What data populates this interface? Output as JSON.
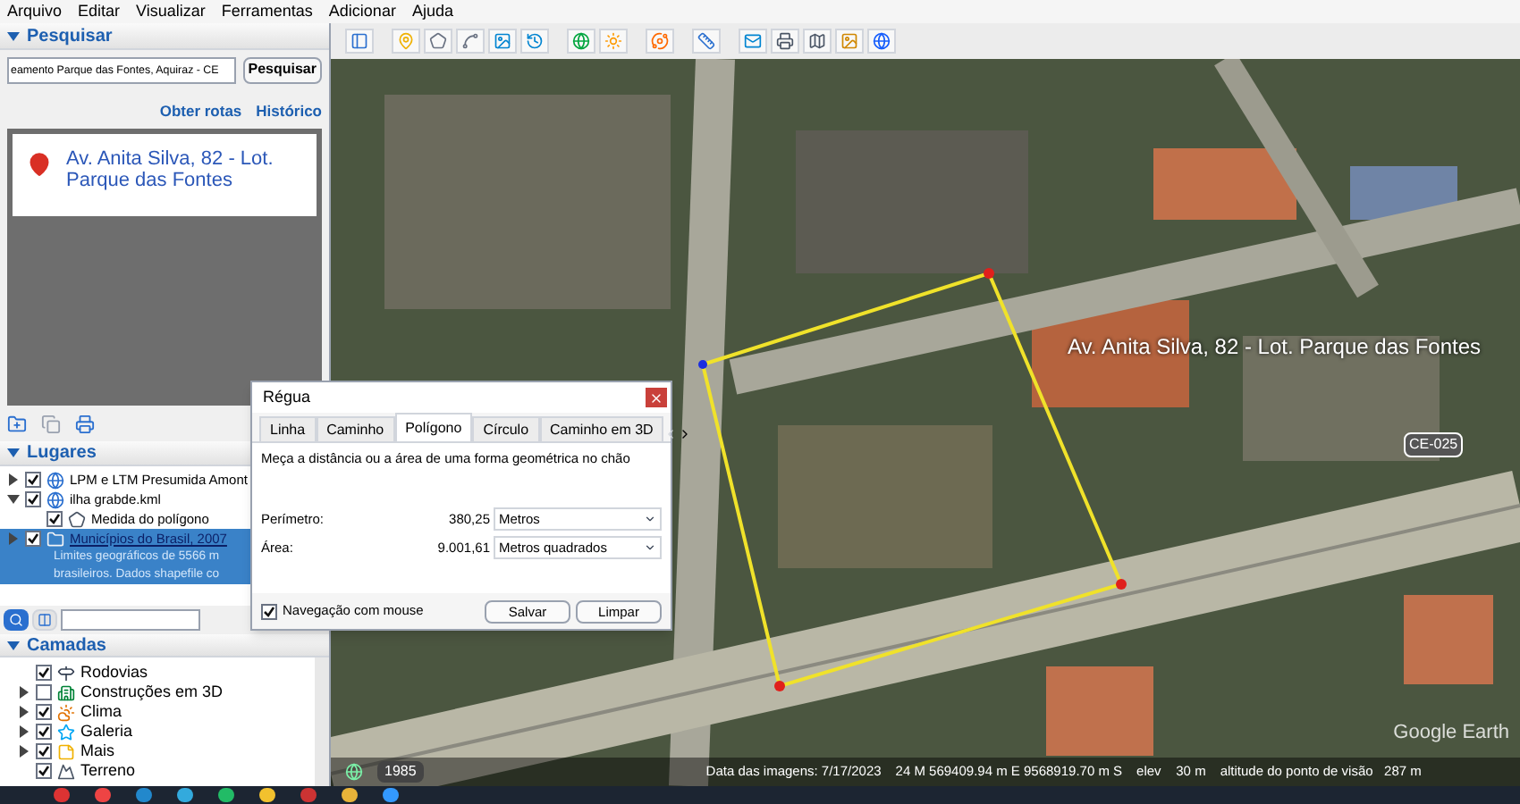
{
  "menu": [
    "Arquivo",
    "Editar",
    "Visualizar",
    "Ferramentas",
    "Adicionar",
    "Ajuda"
  ],
  "search_panel": {
    "title": "Pesquisar",
    "expanded": true,
    "query": "eamento Parque das Fontes, Aquiraz - CE",
    "button": "Pesquisar",
    "links": [
      "Obter rotas",
      "Histórico"
    ],
    "results": [
      {
        "title": "Av. Anita Silva, 82 - Lot. Parque das Fontes"
      }
    ]
  },
  "places": {
    "title": "Lugares",
    "expanded": true,
    "items": [
      {
        "label": "LPM e LTM Presumida Amont",
        "kind": "network",
        "checked": true,
        "expanded": false,
        "selected": false
      },
      {
        "label": "ilha grabde.kml",
        "kind": "network",
        "checked": true,
        "expanded": true,
        "selected": false,
        "children": [
          {
            "label": "Medida do polígono",
            "kind": "polygon",
            "checked": true,
            "selected": false
          }
        ]
      },
      {
        "label": "Municípios do Brasil, 2007",
        "kind": "folder",
        "checked": true,
        "expanded": false,
        "selected": true,
        "description_lines": [
          "Limites geográficos de 5566 m",
          "brasileiros. Dados shapefile co"
        ]
      }
    ]
  },
  "layers": {
    "title": "Camadas",
    "expanded": true,
    "items": [
      {
        "label": "Rodovias",
        "kind": "roads",
        "checked": true
      },
      {
        "label": "Construções em 3D",
        "kind": "buildings",
        "checked": false,
        "expanded": false
      },
      {
        "label": "Clima",
        "kind": "weather",
        "checked": true,
        "expanded": false
      },
      {
        "label": "Galeria",
        "kind": "gallery",
        "checked": true,
        "expanded": false
      },
      {
        "label": "Mais",
        "kind": "more",
        "checked": true,
        "expanded": false
      },
      {
        "label": "Terreno",
        "kind": "terrain",
        "checked": true
      }
    ]
  },
  "ruler_dialog": {
    "title": "Régua",
    "tabs": [
      {
        "label": "Linha",
        "selected": false
      },
      {
        "label": "Caminho",
        "selected": false
      },
      {
        "label": "Polígono",
        "selected": true
      },
      {
        "label": "Círculo",
        "selected": false
      },
      {
        "label": "Caminho em 3D",
        "selected": false
      }
    ],
    "description": "Meça a distância ou a área de uma forma geométrica no chão",
    "measurements": [
      {
        "label": "Perímetro:",
        "value": "380,25",
        "unit": "Metros"
      },
      {
        "label": "Área:",
        "value": "9.001,61",
        "unit": "Metros quadrados"
      }
    ],
    "mouse_navigation": {
      "label": "Navegação com mouse",
      "checked": true
    },
    "buttons": [
      "Salvar",
      "Limpar"
    ]
  },
  "map": {
    "place_label": "Av. Anita Silva, 82 - Lot. Parque das Fontes",
    "road_shield": "CE-025",
    "logo": "Google Earth",
    "status": {
      "year": "1985",
      "imagery_date": "Data das imagens: 7/17/2023",
      "coordinates": "24 M 569409.94 m E 9568919.70 m S",
      "elevation": "elev    30 m",
      "eye_altitude": "altitude do ponto de visão   287 m"
    }
  }
}
